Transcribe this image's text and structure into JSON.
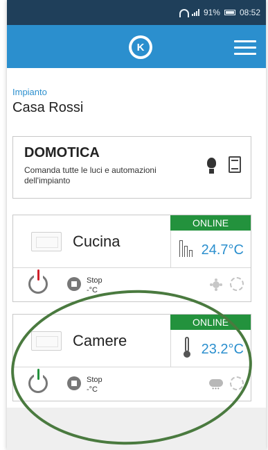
{
  "status_bar": {
    "battery": "91%",
    "time": "08:52"
  },
  "app": {
    "logo_text": "K",
    "menu_icon": "hamburger-menu-icon"
  },
  "plant": {
    "caption": "Impianto",
    "name": "Casa Rossi"
  },
  "domotica": {
    "title": "DOMOTICA",
    "description": "Comanda tutte le luci e automazioni dell'impianto",
    "icons": [
      "lightbulb-icon",
      "blind-icon"
    ]
  },
  "rooms": [
    {
      "name": "Cucina",
      "status": "ONLINE",
      "temperature": "24.7°C",
      "sensor_icon": "level-bars-icon",
      "power_color": "#d0202a",
      "mode": "Stop",
      "setpoint": "-°C",
      "weather_icon": "sun-icon"
    },
    {
      "name": "Camere",
      "status": "ONLINE",
      "temperature": "23.2°C",
      "sensor_icon": "thermometer-icon",
      "power_color": "#23923d",
      "mode": "Stop",
      "setpoint": "-°C",
      "weather_icon": "rain-cloud-icon"
    }
  ],
  "colors": {
    "accent": "#2b8fce",
    "status_bar": "#1f3f5a",
    "online": "#23923d",
    "annotation": "#4a7a3f"
  }
}
